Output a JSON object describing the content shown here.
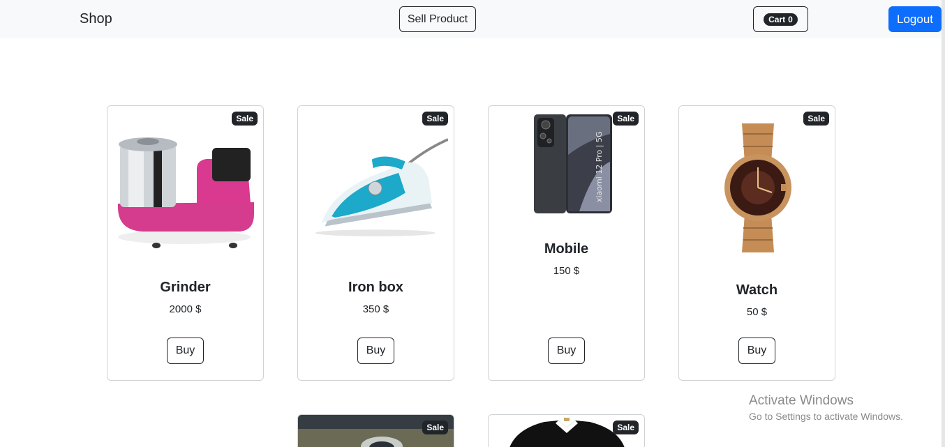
{
  "navbar": {
    "brand": "Shop",
    "sell_label": "Sell Product",
    "cart_label": "Cart",
    "cart_count": "0",
    "logout_label": "Logout"
  },
  "products": [
    {
      "name": "Grinder",
      "price": "2000 $",
      "badge": "Sale",
      "buy_label": "Buy",
      "icon": "grinder-image"
    },
    {
      "name": "Iron box",
      "price": "350 $",
      "badge": "Sale",
      "buy_label": "Buy",
      "icon": "iron-box-image"
    },
    {
      "name": "Mobile",
      "price": "150 $",
      "badge": "Sale",
      "buy_label": "Buy",
      "icon": "mobile-image"
    },
    {
      "name": "Watch",
      "price": "50 $",
      "badge": "Sale",
      "buy_label": "Buy",
      "icon": "watch-image"
    }
  ],
  "products_row2": [
    {
      "badge": "Sale",
      "icon": "sunglasses-image"
    },
    {
      "badge": "Sale",
      "icon": "polo-shirt-image"
    }
  ],
  "watermark": {
    "title": "Activate Windows",
    "subtitle": "Go to Settings to activate Windows."
  },
  "colors": {
    "navbar_bg": "#f8f9fa",
    "primary": "#0d6efd",
    "dark": "#212529"
  }
}
